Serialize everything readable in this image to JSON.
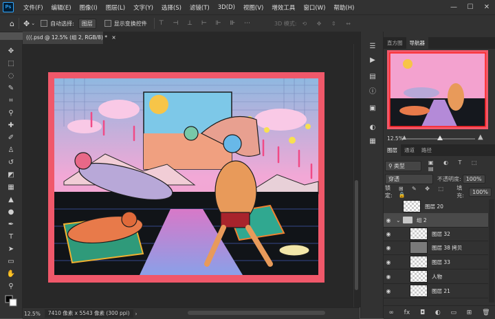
{
  "app": {
    "logo": "Ps"
  },
  "menu": [
    "文件(F)",
    "编辑(E)",
    "图像(I)",
    "图层(L)",
    "文字(Y)",
    "选择(S)",
    "滤镜(T)",
    "3D(D)",
    "视图(V)",
    "增效工具",
    "窗口(W)",
    "帮助(H)"
  ],
  "options": {
    "auto_select_label": "自动选择:",
    "auto_select_value": "图层",
    "show_transform_label": "显示变换控件",
    "mode_3d": "3D 模式:"
  },
  "document": {
    "tab_title": "(((.psd @ 12.5% (组 2, RGB/8) *",
    "zoom": "12.5%",
    "info": "7410 像素 x 5543 像素 (300 ppi)"
  },
  "navigator": {
    "tabs": [
      "直方图",
      "导航器"
    ],
    "zoom": "12.5%"
  },
  "layers": {
    "tabs": [
      "图层",
      "通道",
      "路径"
    ],
    "filter_kind": "类型",
    "blend_mode": "穿透",
    "opacity_label": "不透明度:",
    "opacity_value": "100%",
    "lock_label": "锁定:",
    "fill_label": "填充:",
    "fill_value": "100%",
    "items": [
      {
        "name": "图层 20"
      },
      {
        "name": "组 2"
      },
      {
        "name": "图层 32"
      },
      {
        "name": "图层 38 拷贝"
      },
      {
        "name": "图层 33"
      },
      {
        "name": "人物"
      },
      {
        "name": "图层 21"
      }
    ]
  },
  "colors": {
    "accent": "#31a8ff",
    "canvas_frame": "#f0586a",
    "artwork_bg": "#f59ac8"
  }
}
